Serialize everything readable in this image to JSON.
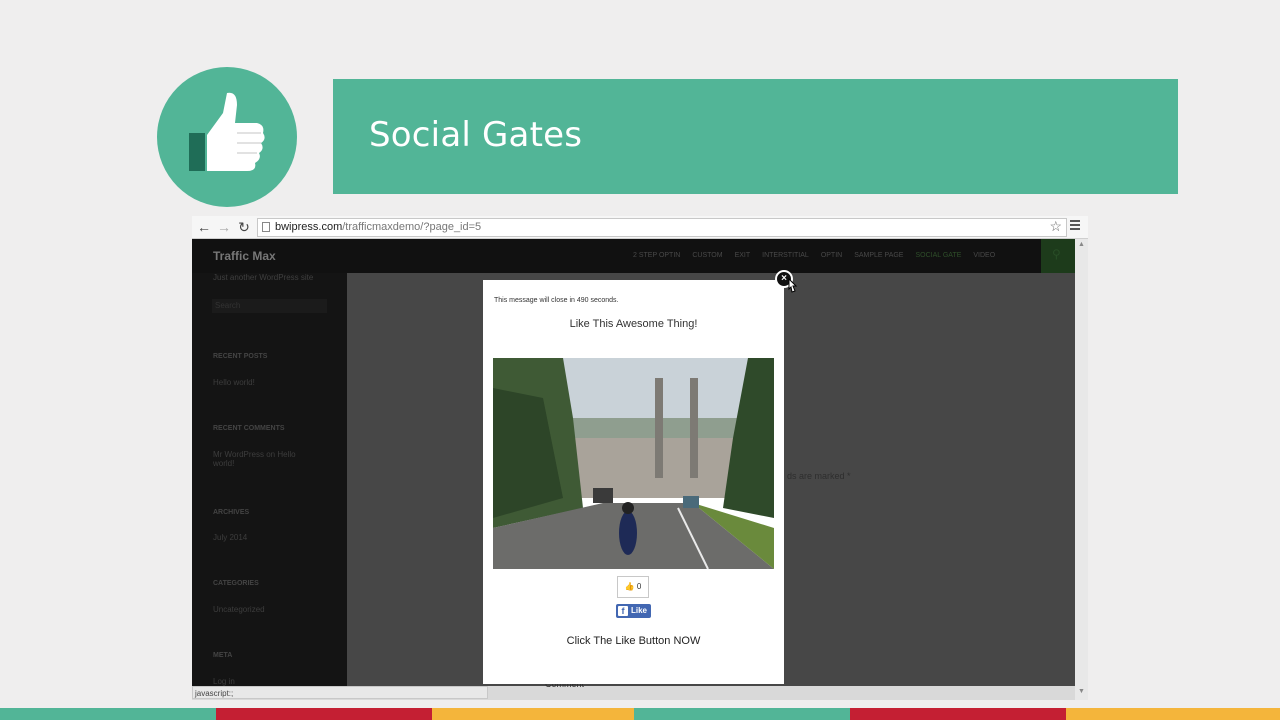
{
  "slide": {
    "title": "Social Gates",
    "icon": "thumbs-up-icon",
    "colors": {
      "accent_green": "#52b597",
      "stripe_red": "#c41f33",
      "stripe_yellow": "#f4b53b"
    }
  },
  "browser": {
    "url_host": "bwipress.com",
    "url_path": "/trafficmaxdemo/?page_id=5",
    "status_text": "javascript:;"
  },
  "site": {
    "title": "Traffic Max",
    "description": "Just another WordPress site",
    "nav": [
      "2 STEP OPTIN",
      "CUSTOM",
      "EXIT",
      "INTERSTITIAL",
      "OPTIN",
      "SAMPLE PAGE",
      "SOCIAL GATE",
      "VIDEO"
    ],
    "search_placeholder": "Search",
    "sidebar": {
      "recent_posts_heading": "RECENT POSTS",
      "recent_post": "Hello world!",
      "recent_comments_heading": "RECENT COMMENTS",
      "recent_comment": "Mr WordPress on Hello world!",
      "archives_heading": "ARCHIVES",
      "archive": "July 2014",
      "categories_heading": "CATEGORIES",
      "category": "Uncategorized",
      "meta_heading": "META",
      "meta_link": "Log in"
    },
    "content_fragment": "ds are marked *",
    "content_bottom": "Comment"
  },
  "popup": {
    "countdown": "This message will close in 490 seconds.",
    "heading": "Like This Awesome Thing!",
    "like_count": "0",
    "fb_like_label": "Like",
    "cta": "Click The Like Button NOW"
  }
}
